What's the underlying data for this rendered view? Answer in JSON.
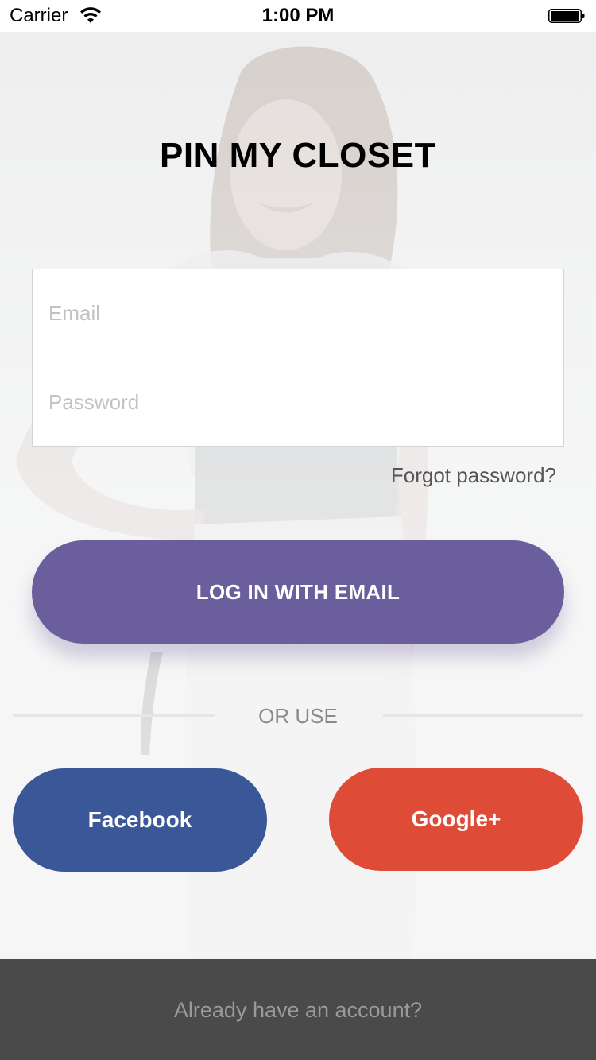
{
  "status_bar": {
    "carrier": "Carrier",
    "time": "1:00 PM",
    "wifi_icon": "wifi-icon",
    "battery_icon": "battery-icon"
  },
  "app": {
    "title": "PIN MY CLOSET"
  },
  "login_form": {
    "email_placeholder": "Email",
    "email_value": "",
    "password_placeholder": "Password",
    "password_value": ""
  },
  "forgot_password_label": "Forgot password?",
  "login_button_label": "LOG IN WITH EMAIL",
  "or_label": "OR USE",
  "social": {
    "facebook_label": "Facebook",
    "google_label": "Google+"
  },
  "footer": {
    "account_label": "Already have an account?"
  },
  "colors": {
    "primary": "#6a5f9c",
    "facebook": "#3a5897",
    "google": "#de4b37",
    "footer_bg": "#4a4a4a"
  }
}
